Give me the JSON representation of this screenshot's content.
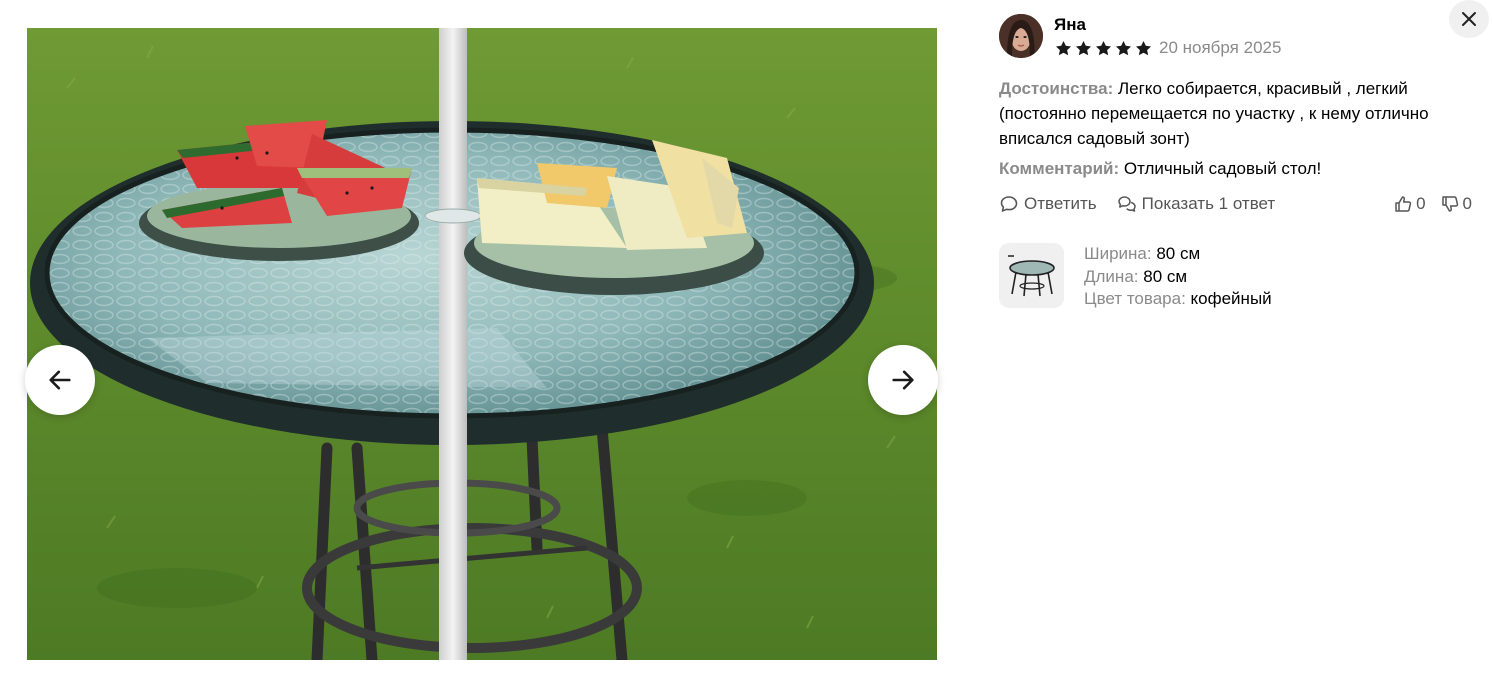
{
  "gallery": {
    "photo_subject": "table-photo",
    "prev_icon": "arrow-left-icon",
    "next_icon": "arrow-right-icon"
  },
  "review": {
    "author_name": "Яна",
    "rating": 5,
    "rating_max": 5,
    "date": "20 ноября 2025",
    "advantages_label": "Достоинства:",
    "advantages_text": "Легко собирается, красивый , легкий (постоянно перемещается по участку , к нему отлично вписался садовый зонт)",
    "comment_label": "Комментарий:",
    "comment_text": "Отличный садовый стол!",
    "actions": {
      "reply_label": "Ответить",
      "show_replies_label": "Показать 1 ответ",
      "likes": "0",
      "dislikes": "0"
    },
    "product": {
      "specs": [
        {
          "key": "Ширина:",
          "value": "80 см"
        },
        {
          "key": "Длина:",
          "value": "80 см"
        },
        {
          "key": "Цвет товара:",
          "value": "кофейный"
        }
      ]
    }
  },
  "colors": {
    "star": "#1a1a1a",
    "label_gray": "#8a8a8a",
    "close_bg": "#f0f0f0"
  }
}
